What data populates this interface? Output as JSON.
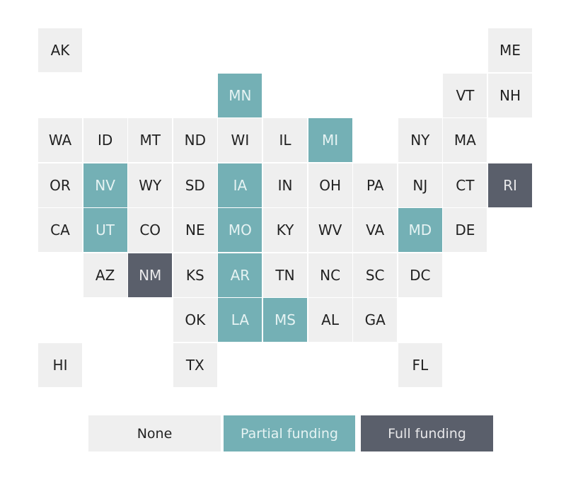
{
  "colors": {
    "none": "#efefef",
    "partial": "#74b0b5",
    "full": "#5a5f6b"
  },
  "states": {
    "AK": "none",
    "ME": "none",
    "MN": "partial",
    "VT": "none",
    "NH": "none",
    "WA": "none",
    "ID": "none",
    "MT": "none",
    "ND": "none",
    "WI": "none",
    "IL": "none",
    "MI": "partial",
    "NY": "none",
    "MA": "none",
    "OR": "none",
    "NV": "partial",
    "WY": "none",
    "SD": "none",
    "IA": "partial",
    "IN": "none",
    "OH": "none",
    "PA": "none",
    "NJ": "none",
    "CT": "none",
    "RI": "full",
    "CA": "none",
    "UT": "partial",
    "CO": "none",
    "NE": "none",
    "MO": "partial",
    "KY": "none",
    "WV": "none",
    "VA": "none",
    "MD": "partial",
    "DE": "none",
    "AZ": "none",
    "NM": "full",
    "KS": "none",
    "AR": "partial",
    "TN": "none",
    "NC": "none",
    "SC": "none",
    "DC": "none",
    "OK": "none",
    "LA": "partial",
    "MS": "partial",
    "AL": "none",
    "GA": "none",
    "HI": "none",
    "TX": "none",
    "FL": "none"
  },
  "legend": {
    "none": "None",
    "partial": "Partial funding",
    "full": "Full funding"
  }
}
